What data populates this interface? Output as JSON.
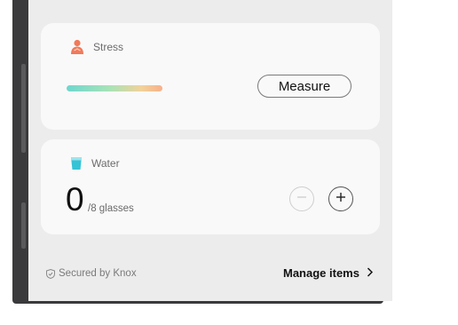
{
  "stress_card": {
    "title": "Stress",
    "icon": "stress-person-icon",
    "measure_label": "Measure",
    "icon_color": "#f07a5a"
  },
  "water_card": {
    "title": "Water",
    "icon": "water-glass-icon",
    "count": "0",
    "unit": "/8 glasses",
    "icon_color": "#35c3d6"
  },
  "footer": {
    "secured_label": "Secured by Knox",
    "manage_label": "Manage items"
  }
}
